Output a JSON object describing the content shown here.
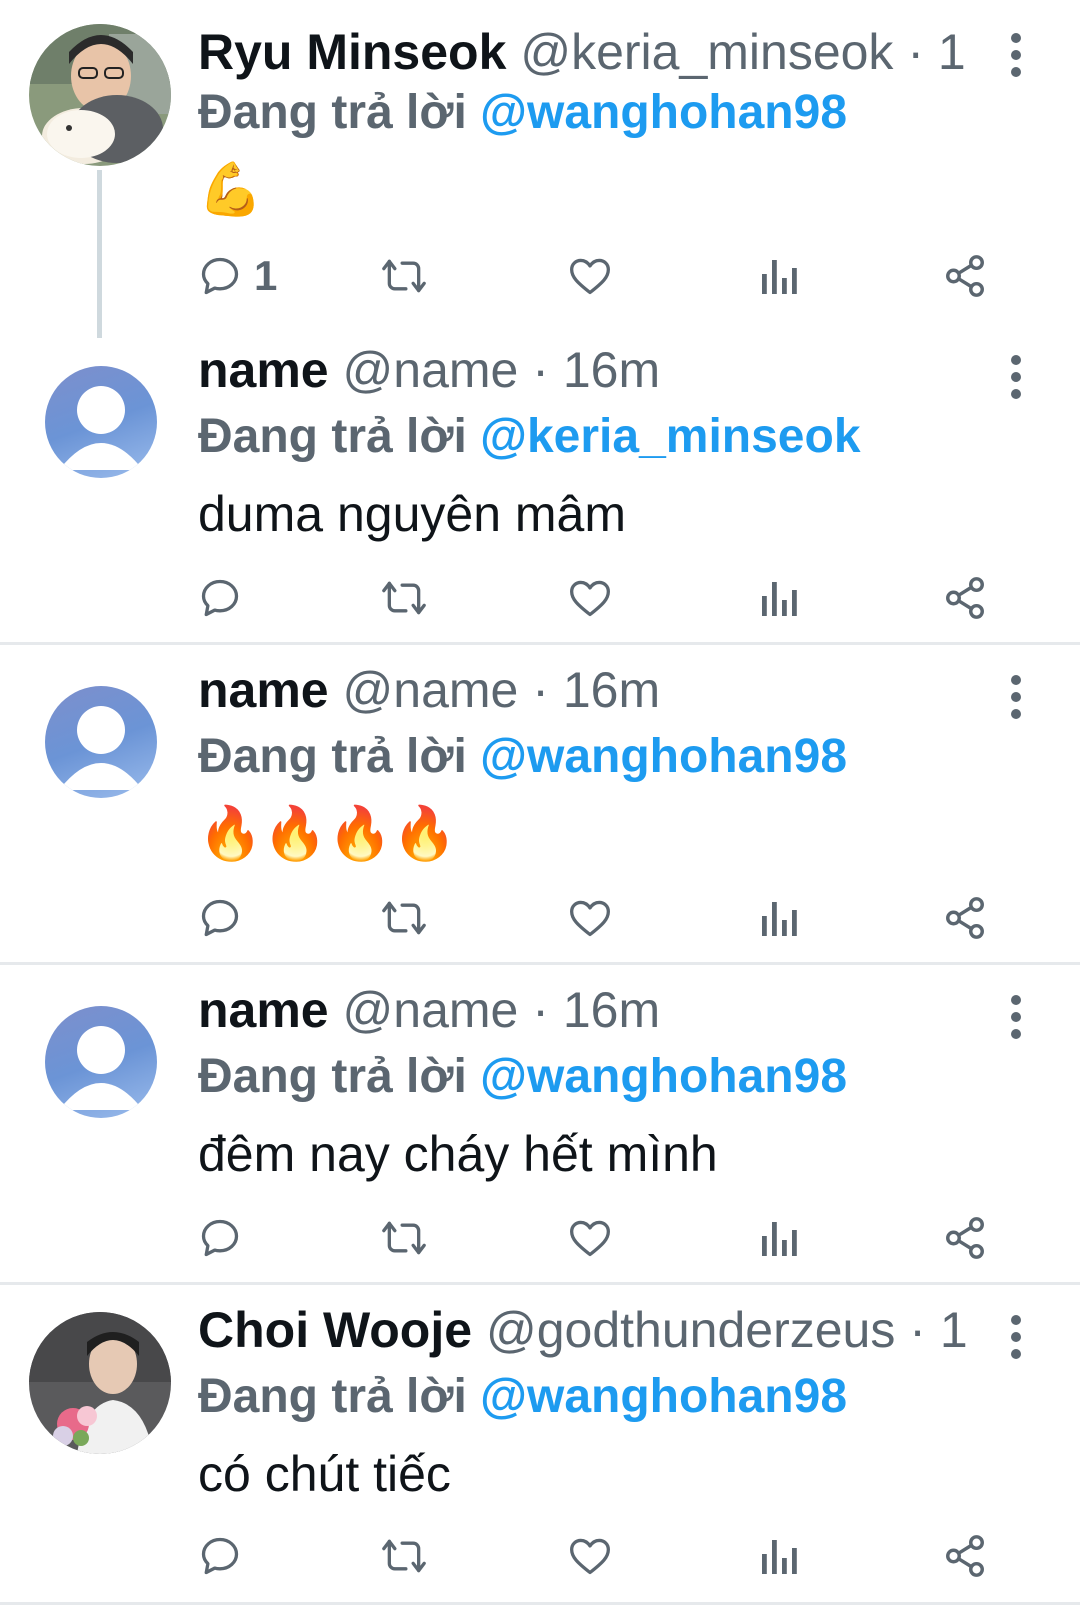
{
  "tweets": [
    {
      "name": "Ryu Minseok",
      "handle": "@keria_minseok",
      "separator": "·",
      "time": "1...",
      "replying_label": "Đang trả lời",
      "replying_to": "@wanghohan98",
      "body": "💪",
      "avatar": "photo-avatar",
      "reply_count": "1"
    },
    {
      "name": "name",
      "handle": "@name",
      "separator": "·",
      "time": "16m",
      "replying_label": "Đang trả lời",
      "replying_to": "@keria_minseok",
      "body": "duma nguyên mâm",
      "avatar": "default-avatar",
      "reply_count": ""
    },
    {
      "name": "name",
      "handle": "@name",
      "separator": "·",
      "time": "16m",
      "replying_label": "Đang trả lời",
      "replying_to": "@wanghohan98",
      "body": "🔥🔥🔥🔥",
      "avatar": "default-avatar",
      "reply_count": ""
    },
    {
      "name": "name",
      "handle": "@name",
      "separator": "·",
      "time": "16m",
      "replying_label": "Đang trả lời",
      "replying_to": "@wanghohan98",
      "body": "đêm nay cháy hết mình",
      "avatar": "default-avatar",
      "reply_count": ""
    },
    {
      "name": "Choi Wooje",
      "handle": "@godthunderzeus",
      "separator": "·",
      "time": "1...",
      "replying_label": "Đang trả lời",
      "replying_to": "@wanghohan98",
      "body": "có chút tiếc",
      "avatar": "photo-avatar",
      "reply_count": ""
    }
  ],
  "icons": {
    "reply": "reply-icon",
    "retweet": "retweet-icon",
    "like": "heart-icon",
    "views": "views-icon",
    "share": "share-icon",
    "more": "more-vertical-icon"
  },
  "colors": {
    "mention": "#1d9bf0",
    "secondary_text": "#5b6670",
    "primary_text": "#0f1419",
    "divider": "#e6e9ec",
    "thread_line": "#cfd9de"
  }
}
